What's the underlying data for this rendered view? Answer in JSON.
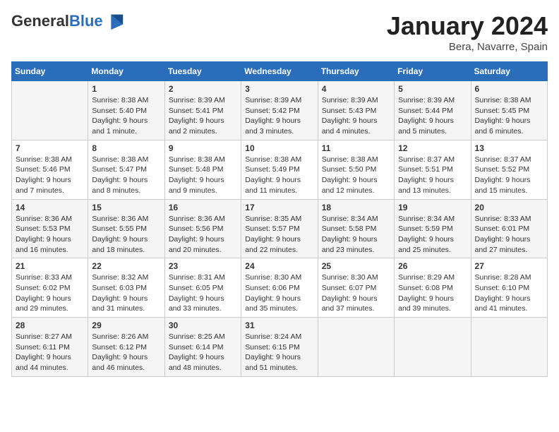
{
  "header": {
    "logo_general": "General",
    "logo_blue": "Blue",
    "month_title": "January 2024",
    "location": "Bera, Navarre, Spain"
  },
  "days_of_week": [
    "Sunday",
    "Monday",
    "Tuesday",
    "Wednesday",
    "Thursday",
    "Friday",
    "Saturday"
  ],
  "weeks": [
    [
      {
        "day": "",
        "info": ""
      },
      {
        "day": "1",
        "info": "Sunrise: 8:38 AM\nSunset: 5:40 PM\nDaylight: 9 hours\nand 1 minute."
      },
      {
        "day": "2",
        "info": "Sunrise: 8:39 AM\nSunset: 5:41 PM\nDaylight: 9 hours\nand 2 minutes."
      },
      {
        "day": "3",
        "info": "Sunrise: 8:39 AM\nSunset: 5:42 PM\nDaylight: 9 hours\nand 3 minutes."
      },
      {
        "day": "4",
        "info": "Sunrise: 8:39 AM\nSunset: 5:43 PM\nDaylight: 9 hours\nand 4 minutes."
      },
      {
        "day": "5",
        "info": "Sunrise: 8:39 AM\nSunset: 5:44 PM\nDaylight: 9 hours\nand 5 minutes."
      },
      {
        "day": "6",
        "info": "Sunrise: 8:38 AM\nSunset: 5:45 PM\nDaylight: 9 hours\nand 6 minutes."
      }
    ],
    [
      {
        "day": "7",
        "info": "Sunrise: 8:38 AM\nSunset: 5:46 PM\nDaylight: 9 hours\nand 7 minutes."
      },
      {
        "day": "8",
        "info": "Sunrise: 8:38 AM\nSunset: 5:47 PM\nDaylight: 9 hours\nand 8 minutes."
      },
      {
        "day": "9",
        "info": "Sunrise: 8:38 AM\nSunset: 5:48 PM\nDaylight: 9 hours\nand 9 minutes."
      },
      {
        "day": "10",
        "info": "Sunrise: 8:38 AM\nSunset: 5:49 PM\nDaylight: 9 hours\nand 11 minutes."
      },
      {
        "day": "11",
        "info": "Sunrise: 8:38 AM\nSunset: 5:50 PM\nDaylight: 9 hours\nand 12 minutes."
      },
      {
        "day": "12",
        "info": "Sunrise: 8:37 AM\nSunset: 5:51 PM\nDaylight: 9 hours\nand 13 minutes."
      },
      {
        "day": "13",
        "info": "Sunrise: 8:37 AM\nSunset: 5:52 PM\nDaylight: 9 hours\nand 15 minutes."
      }
    ],
    [
      {
        "day": "14",
        "info": "Sunrise: 8:36 AM\nSunset: 5:53 PM\nDaylight: 9 hours\nand 16 minutes."
      },
      {
        "day": "15",
        "info": "Sunrise: 8:36 AM\nSunset: 5:55 PM\nDaylight: 9 hours\nand 18 minutes."
      },
      {
        "day": "16",
        "info": "Sunrise: 8:36 AM\nSunset: 5:56 PM\nDaylight: 9 hours\nand 20 minutes."
      },
      {
        "day": "17",
        "info": "Sunrise: 8:35 AM\nSunset: 5:57 PM\nDaylight: 9 hours\nand 22 minutes."
      },
      {
        "day": "18",
        "info": "Sunrise: 8:34 AM\nSunset: 5:58 PM\nDaylight: 9 hours\nand 23 minutes."
      },
      {
        "day": "19",
        "info": "Sunrise: 8:34 AM\nSunset: 5:59 PM\nDaylight: 9 hours\nand 25 minutes."
      },
      {
        "day": "20",
        "info": "Sunrise: 8:33 AM\nSunset: 6:01 PM\nDaylight: 9 hours\nand 27 minutes."
      }
    ],
    [
      {
        "day": "21",
        "info": "Sunrise: 8:33 AM\nSunset: 6:02 PM\nDaylight: 9 hours\nand 29 minutes."
      },
      {
        "day": "22",
        "info": "Sunrise: 8:32 AM\nSunset: 6:03 PM\nDaylight: 9 hours\nand 31 minutes."
      },
      {
        "day": "23",
        "info": "Sunrise: 8:31 AM\nSunset: 6:05 PM\nDaylight: 9 hours\nand 33 minutes."
      },
      {
        "day": "24",
        "info": "Sunrise: 8:30 AM\nSunset: 6:06 PM\nDaylight: 9 hours\nand 35 minutes."
      },
      {
        "day": "25",
        "info": "Sunrise: 8:30 AM\nSunset: 6:07 PM\nDaylight: 9 hours\nand 37 minutes."
      },
      {
        "day": "26",
        "info": "Sunrise: 8:29 AM\nSunset: 6:08 PM\nDaylight: 9 hours\nand 39 minutes."
      },
      {
        "day": "27",
        "info": "Sunrise: 8:28 AM\nSunset: 6:10 PM\nDaylight: 9 hours\nand 41 minutes."
      }
    ],
    [
      {
        "day": "28",
        "info": "Sunrise: 8:27 AM\nSunset: 6:11 PM\nDaylight: 9 hours\nand 44 minutes."
      },
      {
        "day": "29",
        "info": "Sunrise: 8:26 AM\nSunset: 6:12 PM\nDaylight: 9 hours\nand 46 minutes."
      },
      {
        "day": "30",
        "info": "Sunrise: 8:25 AM\nSunset: 6:14 PM\nDaylight: 9 hours\nand 48 minutes."
      },
      {
        "day": "31",
        "info": "Sunrise: 8:24 AM\nSunset: 6:15 PM\nDaylight: 9 hours\nand 51 minutes."
      },
      {
        "day": "",
        "info": ""
      },
      {
        "day": "",
        "info": ""
      },
      {
        "day": "",
        "info": ""
      }
    ]
  ]
}
